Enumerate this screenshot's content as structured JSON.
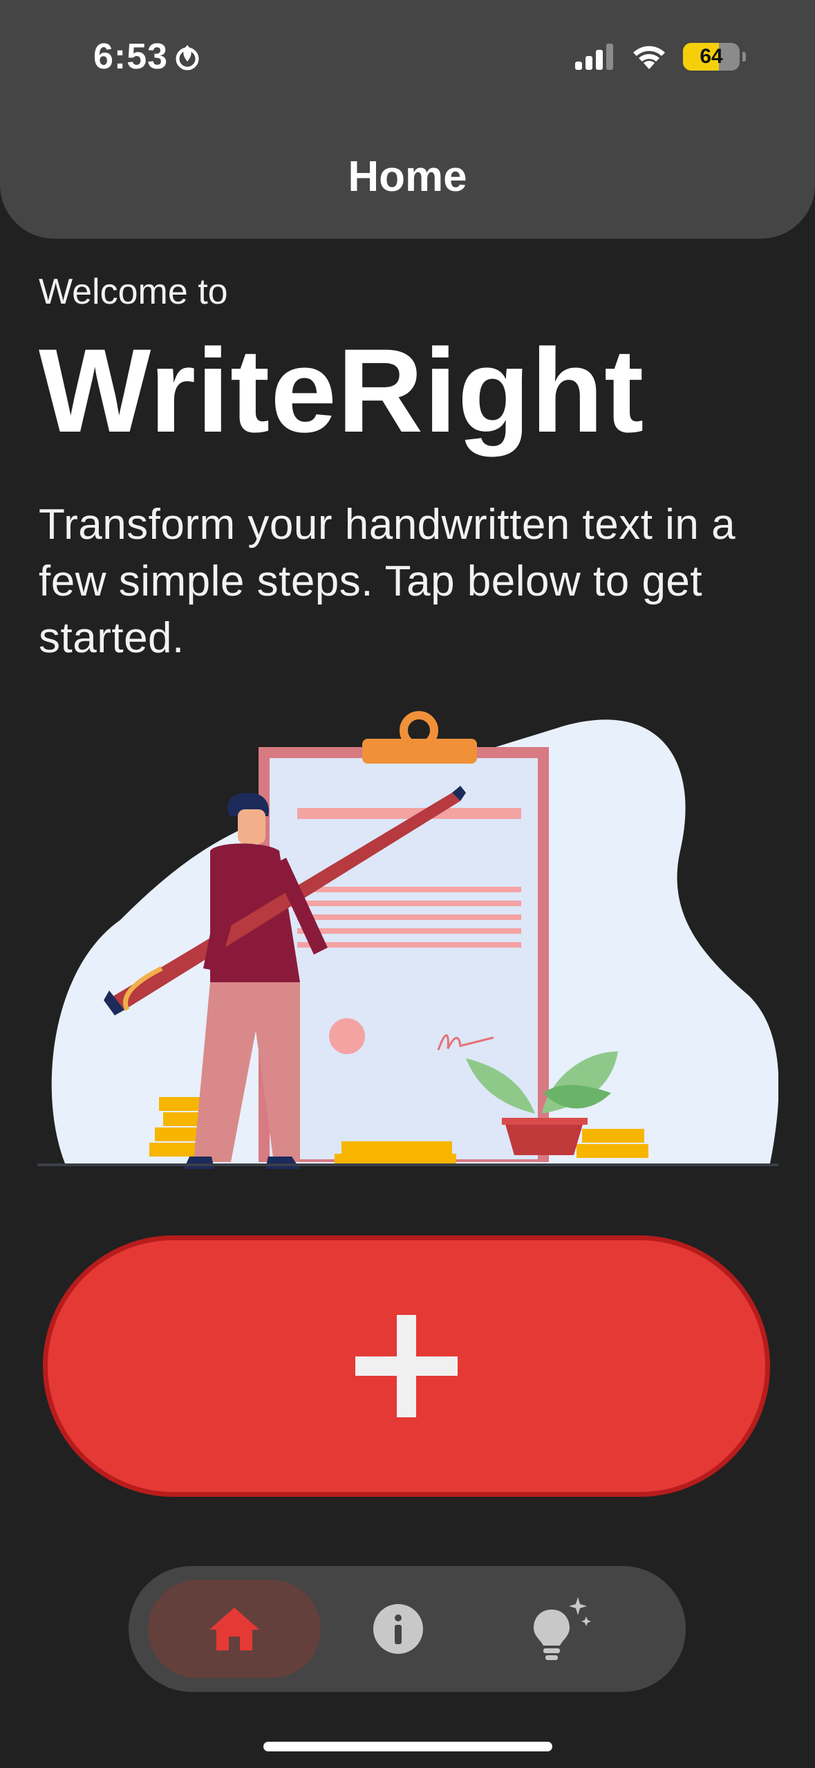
{
  "status_bar": {
    "time": "6:53",
    "battery_level": "64",
    "battery_fraction": 0.64,
    "icons": [
      "hotspot-icon",
      "cellular-signal-icon",
      "wifi-icon",
      "battery-icon"
    ]
  },
  "header": {
    "title": "Home"
  },
  "main": {
    "welcome": "Welcome to",
    "app_name": "WriteRight",
    "description": "Transform your handwritten text in a few simple steps. Tap below to get started."
  },
  "add_button": {
    "icon": "plus-icon"
  },
  "tab_bar": {
    "tabs": [
      {
        "name": "home",
        "icon": "home-icon",
        "active": true
      },
      {
        "name": "info",
        "icon": "info-icon",
        "active": false
      },
      {
        "name": "tips",
        "icon": "lightbulb-icon",
        "active": false
      }
    ]
  },
  "colors": {
    "background": "#212121",
    "header": "#454545",
    "accent_red": "#e53935",
    "accent_red_border": "#b71c1c",
    "battery": "#f5d00a"
  }
}
